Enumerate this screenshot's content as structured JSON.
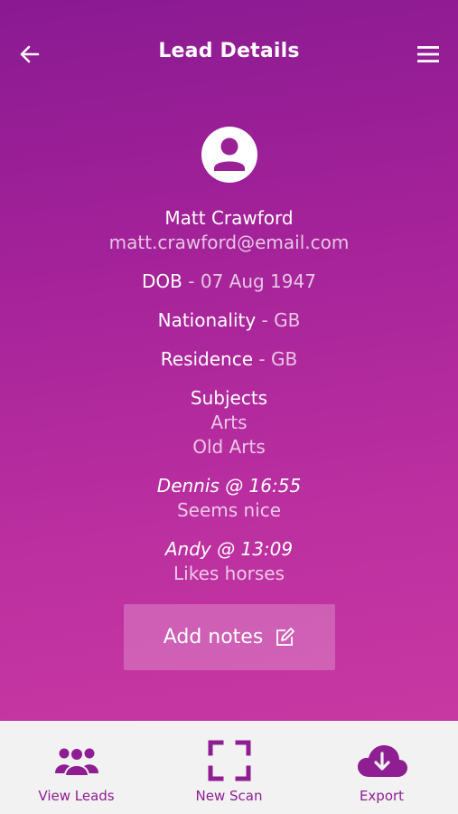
{
  "header": {
    "title": "Lead Details",
    "back_icon": "arrow-left-icon",
    "menu_icon": "hamburger-menu-icon"
  },
  "lead": {
    "name": "Matt Crawford",
    "email": "matt.crawford@email.com",
    "dob_label": "DOB",
    "dob_value": "07 Aug 1947",
    "nationality_label": "Nationality",
    "nationality_value": "GB",
    "residence_label": "Residence",
    "residence_value": "GB",
    "subjects_label": "Subjects",
    "subjects": [
      "Arts",
      "Old Arts"
    ]
  },
  "notes": [
    {
      "author": "Dennis @ 16:55",
      "text": "Seems nice"
    },
    {
      "author": "Andy @ 13:09",
      "text": "Likes horses"
    }
  ],
  "add_notes_label": "Add notes",
  "bottom_nav": [
    {
      "label": "View Leads",
      "icon": "people-group-icon"
    },
    {
      "label": "New Scan",
      "icon": "scan-frame-icon"
    },
    {
      "label": "Export",
      "icon": "cloud-download-icon"
    }
  ],
  "colors": {
    "brand": "#8f1e92",
    "gradient_top": "#8a1a92",
    "gradient_bottom": "#c838a2",
    "nav_bg": "#f2f2f2"
  }
}
